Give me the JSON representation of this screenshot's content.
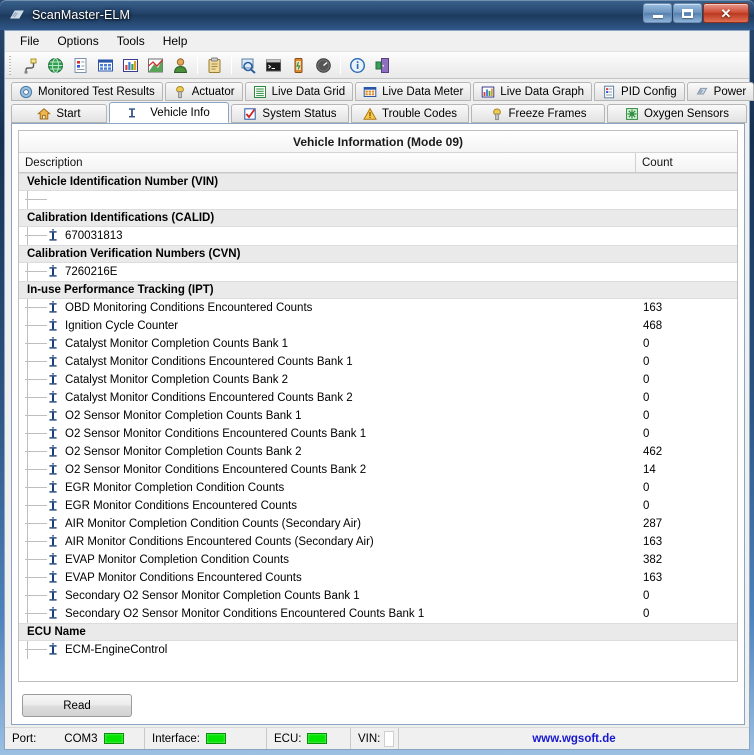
{
  "window": {
    "title": "ScanMaster-ELM",
    "icon": "chip-icon",
    "buttons": {
      "minimize": "minimize-button",
      "maximize": "maximize-button",
      "close_glyph": "✕"
    }
  },
  "menu": {
    "items": [
      {
        "label": "File"
      },
      {
        "label": "Options"
      },
      {
        "label": "Tools"
      },
      {
        "label": "Help"
      }
    ]
  },
  "toolbar": {
    "buttons": [
      {
        "name": "connect-icon"
      },
      {
        "name": "globe-icon"
      },
      {
        "name": "report-icon"
      },
      {
        "name": "grid-icon"
      },
      {
        "name": "chart-icon"
      },
      {
        "name": "graph-icon"
      },
      {
        "name": "user-icon"
      },
      {
        "name": "clipboard-icon"
      },
      {
        "name": "inspect-icon"
      },
      {
        "name": "terminal-icon"
      },
      {
        "name": "battery-icon"
      },
      {
        "name": "gauge-icon"
      },
      {
        "name": "info-icon"
      },
      {
        "name": "exit-icon"
      }
    ]
  },
  "tabs": {
    "row1": [
      {
        "label": "Monitored Test Results",
        "icon": "gear-icon",
        "active": false
      },
      {
        "label": "Actuator",
        "icon": "plug-icon",
        "active": false
      },
      {
        "label": "Live Data Grid",
        "icon": "list-icon",
        "active": false
      },
      {
        "label": "Live Data Meter",
        "icon": "grid-icon",
        "active": false
      },
      {
        "label": "Live Data Graph",
        "icon": "bars-icon",
        "active": false
      },
      {
        "label": "PID Config",
        "icon": "document-icon",
        "active": false
      },
      {
        "label": "Power",
        "icon": "chip-icon",
        "active": false
      }
    ],
    "row2": [
      {
        "label": "Start",
        "icon": "home-icon",
        "active": false
      },
      {
        "label": "Vehicle Info",
        "icon": "info-i-icon",
        "active": true
      },
      {
        "label": "System Status",
        "icon": "checkbox-icon",
        "active": false
      },
      {
        "label": "Trouble Codes",
        "icon": "warning-icon",
        "active": false
      },
      {
        "label": "Freeze Frames",
        "icon": "snow-icon",
        "active": false
      },
      {
        "label": "Oxygen Sensors",
        "icon": "sensor-icon",
        "active": false
      }
    ]
  },
  "grid": {
    "title": "Vehicle Information (Mode 09)",
    "columns": [
      "Description",
      "Count"
    ],
    "rows": [
      {
        "type": "group",
        "label": "Vehicle Identification Number (VIN)",
        "value": ""
      },
      {
        "type": "blank",
        "label": "",
        "value": ""
      },
      {
        "type": "group",
        "label": "Calibration Identifications (CALID)",
        "value": ""
      },
      {
        "type": "item",
        "label": "670031813",
        "value": ""
      },
      {
        "type": "group",
        "label": "Calibration Verification Numbers (CVN)",
        "value": ""
      },
      {
        "type": "item",
        "label": "7260216E",
        "value": ""
      },
      {
        "type": "group",
        "label": "In-use Performance Tracking (IPT)",
        "value": ""
      },
      {
        "type": "item",
        "label": "OBD Monitoring Conditions Encountered Counts",
        "value": "163"
      },
      {
        "type": "item",
        "label": "Ignition  Cycle Counter",
        "value": "468"
      },
      {
        "type": "item",
        "label": "Catalyst Monitor Completion Counts Bank 1",
        "value": "0"
      },
      {
        "type": "item",
        "label": "Catalyst Monitor Conditions Encountered Counts Bank 1",
        "value": "0"
      },
      {
        "type": "item",
        "label": "Catalyst Monitor Completion Counts Bank 2",
        "value": "0"
      },
      {
        "type": "item",
        "label": "Catalyst Monitor Conditions Encountered Counts Bank 2",
        "value": "0"
      },
      {
        "type": "item",
        "label": "O2 Sensor Monitor Completion Counts Bank 1",
        "value": "0"
      },
      {
        "type": "item",
        "label": "O2 Sensor Monitor Conditions Encountered Counts Bank 1",
        "value": "0"
      },
      {
        "type": "item",
        "label": "O2 Sensor Monitor Completion Counts Bank 2",
        "value": "462"
      },
      {
        "type": "item",
        "label": "O2 Sensor Monitor Conditions Encountered Counts Bank 2",
        "value": "14"
      },
      {
        "type": "item",
        "label": "EGR Monitor Completion Condition Counts",
        "value": "0"
      },
      {
        "type": "item",
        "label": "EGR Monitor Conditions Encountered Counts",
        "value": "0"
      },
      {
        "type": "item",
        "label": "AIR Monitor Completion Condition Counts (Secondary Air)",
        "value": "287"
      },
      {
        "type": "item",
        "label": "AIR Monitor Conditions Encountered Counts (Secondary Air)",
        "value": "163"
      },
      {
        "type": "item",
        "label": "EVAP Monitor Completion Condition Counts",
        "value": "382"
      },
      {
        "type": "item",
        "label": "EVAP Monitor Conditions Encountered Counts",
        "value": "163"
      },
      {
        "type": "item",
        "label": "Secondary O2 Sensor Monitor Completion Counts Bank 1",
        "value": "0"
      },
      {
        "type": "item",
        "label": "Secondary O2 Sensor Monitor Conditions Encountered Counts Bank 1",
        "value": "0"
      },
      {
        "type": "group",
        "label": "ECU Name",
        "value": ""
      },
      {
        "type": "item",
        "label": "ECM-EngineControl",
        "value": ""
      }
    ]
  },
  "actions": {
    "read_label": "Read"
  },
  "status": {
    "port_label": "Port:",
    "port_value": "COM3",
    "interface_label": "Interface:",
    "ecu_label": "ECU:",
    "vin_label": "VIN:",
    "vin_value": "",
    "website": "www.wgsoft.de"
  },
  "colors": {
    "led_green": "#00e400",
    "link_blue": "#1818d0",
    "title_blue": "#24456c",
    "group_row": "#eaeaea"
  }
}
